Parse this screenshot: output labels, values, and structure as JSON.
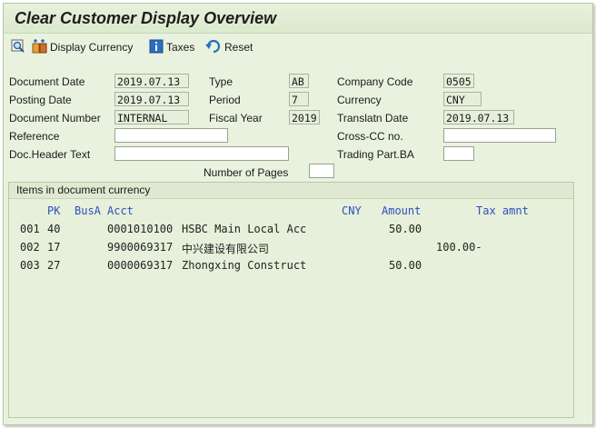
{
  "window": {
    "title": "Clear Customer Display Overview"
  },
  "toolbar": {
    "display_currency_label": "Display Currency",
    "taxes_label": "Taxes",
    "reset_label": "Reset"
  },
  "header": {
    "document_date": {
      "label": "Document Date",
      "value": "2019.07.13"
    },
    "posting_date": {
      "label": "Posting Date",
      "value": "2019.07.13"
    },
    "document_number": {
      "label": "Document Number",
      "value": "INTERNAL"
    },
    "reference": {
      "label": "Reference",
      "value": ""
    },
    "doc_header_text": {
      "label": "Doc.Header Text",
      "value": ""
    },
    "type": {
      "label": "Type",
      "value": "AB"
    },
    "period": {
      "label": "Period",
      "value": "7"
    },
    "fiscal_year": {
      "label": "Fiscal Year",
      "value": "2019"
    },
    "company_code": {
      "label": "Company Code",
      "value": "0505"
    },
    "currency": {
      "label": "Currency",
      "value": "CNY"
    },
    "translatn_date": {
      "label": "Translatn Date",
      "value": "2019.07.13"
    },
    "cross_cc_no": {
      "label": "Cross-CC no.",
      "value": ""
    },
    "trading_part_ba": {
      "label": "Trading Part.BA",
      "value": ""
    },
    "number_of_pages": {
      "label": "Number of Pages",
      "value": ""
    }
  },
  "items": {
    "title": "Items in document currency",
    "columns": {
      "pk": "PK",
      "busa": "BusA",
      "acct": "Acct",
      "currency": "CNY",
      "amount": "Amount",
      "tax_amnt": "Tax amnt"
    },
    "rows": [
      {
        "line": "001",
        "pk": "40",
        "acct": "0001010100",
        "name": "HSBC Main Local Acc",
        "amount": "50.00",
        "tax": ""
      },
      {
        "line": "002",
        "pk": "17",
        "acct": "9900069317",
        "name": "中兴建设有限公司",
        "amount": "",
        "tax": "100.00-"
      },
      {
        "line": "003",
        "pk": "27",
        "acct": "0000069317",
        "name": "Zhongxing Construct",
        "amount": "50.00",
        "tax": ""
      }
    ]
  }
}
